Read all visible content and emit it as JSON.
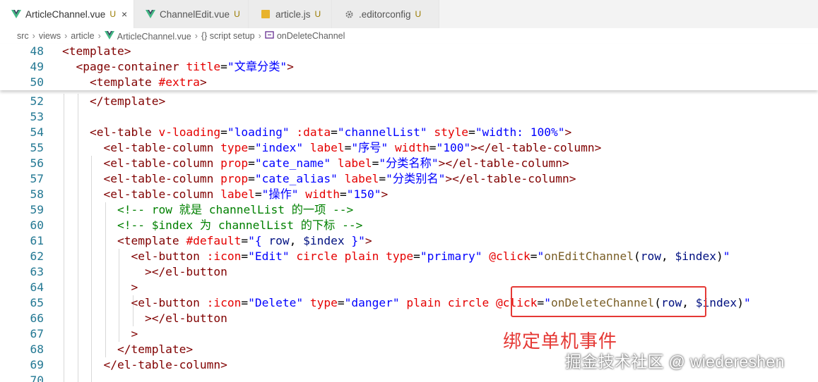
{
  "tabs": [
    {
      "label": "ArticleChannel.vue",
      "mark": "U",
      "icon": "vue-icon",
      "active": true,
      "close": "×"
    },
    {
      "label": "ChannelEdit.vue",
      "mark": "U",
      "icon": "vue-icon"
    },
    {
      "label": "article.js",
      "mark": "U",
      "icon": "js-icon"
    },
    {
      "label": ".editorconfig",
      "mark": "U",
      "icon": "gear-icon"
    }
  ],
  "breadcrumb": [
    "src",
    "views",
    "article",
    "ArticleChannel.vue",
    "{} script setup",
    "onDeleteChannel"
  ],
  "lines": [
    {
      "n": "48",
      "segs": [
        [
          "t",
          "<template>"
        ]
      ]
    },
    {
      "n": "49",
      "segs": [
        [
          "t",
          "  <page-container "
        ],
        [
          "a",
          "title"
        ],
        [
          "p",
          "="
        ],
        [
          "s",
          "\"文章分类\""
        ],
        [
          "t",
          ">"
        ]
      ]
    },
    {
      "n": "50",
      "segs": [
        [
          "t",
          "    <template "
        ],
        [
          "a",
          "#extra"
        ],
        [
          "t",
          ">"
        ]
      ]
    },
    {
      "n": "52",
      "segs": [
        [
          "t",
          "    </template>"
        ]
      ]
    },
    {
      "n": "53",
      "segs": []
    },
    {
      "n": "54",
      "segs": [
        [
          "t",
          "    <el-table "
        ],
        [
          "a",
          "v-loading"
        ],
        [
          "p",
          "="
        ],
        [
          "s",
          "\"loading\" "
        ],
        [
          "a",
          ":data"
        ],
        [
          "p",
          "="
        ],
        [
          "s",
          "\"channelList\" "
        ],
        [
          "a",
          "style"
        ],
        [
          "p",
          "="
        ],
        [
          "s",
          "\"width: 100%\""
        ],
        [
          "t",
          ">"
        ]
      ]
    },
    {
      "n": "55",
      "segs": [
        [
          "t",
          "      <el-table-column "
        ],
        [
          "a",
          "type"
        ],
        [
          "p",
          "="
        ],
        [
          "s",
          "\"index\" "
        ],
        [
          "a",
          "label"
        ],
        [
          "p",
          "="
        ],
        [
          "s",
          "\"序号\" "
        ],
        [
          "a",
          "width"
        ],
        [
          "p",
          "="
        ],
        [
          "s",
          "\"100\""
        ],
        [
          "t",
          "></el-table-column>"
        ]
      ]
    },
    {
      "n": "56",
      "segs": [
        [
          "t",
          "      <el-table-column "
        ],
        [
          "a",
          "prop"
        ],
        [
          "p",
          "="
        ],
        [
          "s",
          "\"cate_name\" "
        ],
        [
          "a",
          "label"
        ],
        [
          "p",
          "="
        ],
        [
          "s",
          "\"分类名称\""
        ],
        [
          "t",
          "></el-table-column>"
        ]
      ]
    },
    {
      "n": "57",
      "segs": [
        [
          "t",
          "      <el-table-column "
        ],
        [
          "a",
          "prop"
        ],
        [
          "p",
          "="
        ],
        [
          "s",
          "\"cate_alias\" "
        ],
        [
          "a",
          "label"
        ],
        [
          "p",
          "="
        ],
        [
          "s",
          "\"分类别名\""
        ],
        [
          "t",
          "></el-table-column>"
        ]
      ]
    },
    {
      "n": "58",
      "segs": [
        [
          "t",
          "      <el-table-column "
        ],
        [
          "a",
          "label"
        ],
        [
          "p",
          "="
        ],
        [
          "s",
          "\"操作\" "
        ],
        [
          "a",
          "width"
        ],
        [
          "p",
          "="
        ],
        [
          "s",
          "\"150\""
        ],
        [
          "t",
          ">"
        ]
      ]
    },
    {
      "n": "59",
      "segs": [
        [
          "c",
          "        <!-- row 就是 channelList 的一项 -->"
        ]
      ]
    },
    {
      "n": "60",
      "segs": [
        [
          "c",
          "        <!-- $index 为 channelList 的下标 -->"
        ]
      ]
    },
    {
      "n": "61",
      "segs": [
        [
          "t",
          "        <template "
        ],
        [
          "a",
          "#default"
        ],
        [
          "p",
          "="
        ],
        [
          "s",
          "\"{ "
        ],
        [
          "v",
          "row"
        ],
        [
          "p",
          ", "
        ],
        [
          "v",
          "$index"
        ],
        [
          "s",
          " }\""
        ],
        [
          "t",
          ">"
        ]
      ]
    },
    {
      "n": "62",
      "segs": [
        [
          "t",
          "          <el-button "
        ],
        [
          "a",
          ":icon"
        ],
        [
          "p",
          "="
        ],
        [
          "s",
          "\"Edit\" "
        ],
        [
          "a",
          "circle plain type"
        ],
        [
          "p",
          "="
        ],
        [
          "s",
          "\"primary\" "
        ],
        [
          "a",
          "@click"
        ],
        [
          "p",
          "="
        ],
        [
          "s",
          "\""
        ],
        [
          "f",
          "onEditChannel"
        ],
        [
          "p",
          "("
        ],
        [
          "v",
          "row"
        ],
        [
          "p",
          ", "
        ],
        [
          "v",
          "$index"
        ],
        [
          "p",
          ")"
        ],
        [
          "s",
          "\""
        ]
      ]
    },
    {
      "n": "63",
      "segs": [
        [
          "t",
          "            ></el-button"
        ]
      ]
    },
    {
      "n": "64",
      "segs": [
        [
          "t",
          "          >"
        ]
      ]
    },
    {
      "n": "65",
      "segs": [
        [
          "t",
          "          <el-button "
        ],
        [
          "a",
          ":icon"
        ],
        [
          "p",
          "="
        ],
        [
          "s",
          "\"Delete\" "
        ],
        [
          "a",
          "type"
        ],
        [
          "p",
          "="
        ],
        [
          "s",
          "\"danger\" "
        ],
        [
          "a",
          "plain circle "
        ],
        [
          "a",
          "@click"
        ],
        [
          "p",
          "="
        ],
        [
          "s",
          "\""
        ],
        [
          "f",
          "onDeleteChannel"
        ],
        [
          "p",
          "("
        ],
        [
          "v",
          "row"
        ],
        [
          "p",
          ", "
        ],
        [
          "v",
          "$index"
        ],
        [
          "p",
          ")"
        ],
        [
          "s",
          "\""
        ]
      ]
    },
    {
      "n": "66",
      "segs": [
        [
          "t",
          "            ></el-button"
        ]
      ]
    },
    {
      "n": "67",
      "segs": [
        [
          "t",
          "          >"
        ]
      ]
    },
    {
      "n": "68",
      "segs": [
        [
          "t",
          "        </template>"
        ]
      ]
    },
    {
      "n": "69",
      "segs": [
        [
          "t",
          "      </el-table-column>"
        ]
      ]
    },
    {
      "n": "70",
      "segs": []
    }
  ],
  "annotation": "绑定单机事件",
  "watermark": "掘金技术社区 @ wiedereshen",
  "colors": {
    "vue_icon": "#41b883",
    "js_icon": "#e8b32d",
    "highlight": "#e53935"
  }
}
